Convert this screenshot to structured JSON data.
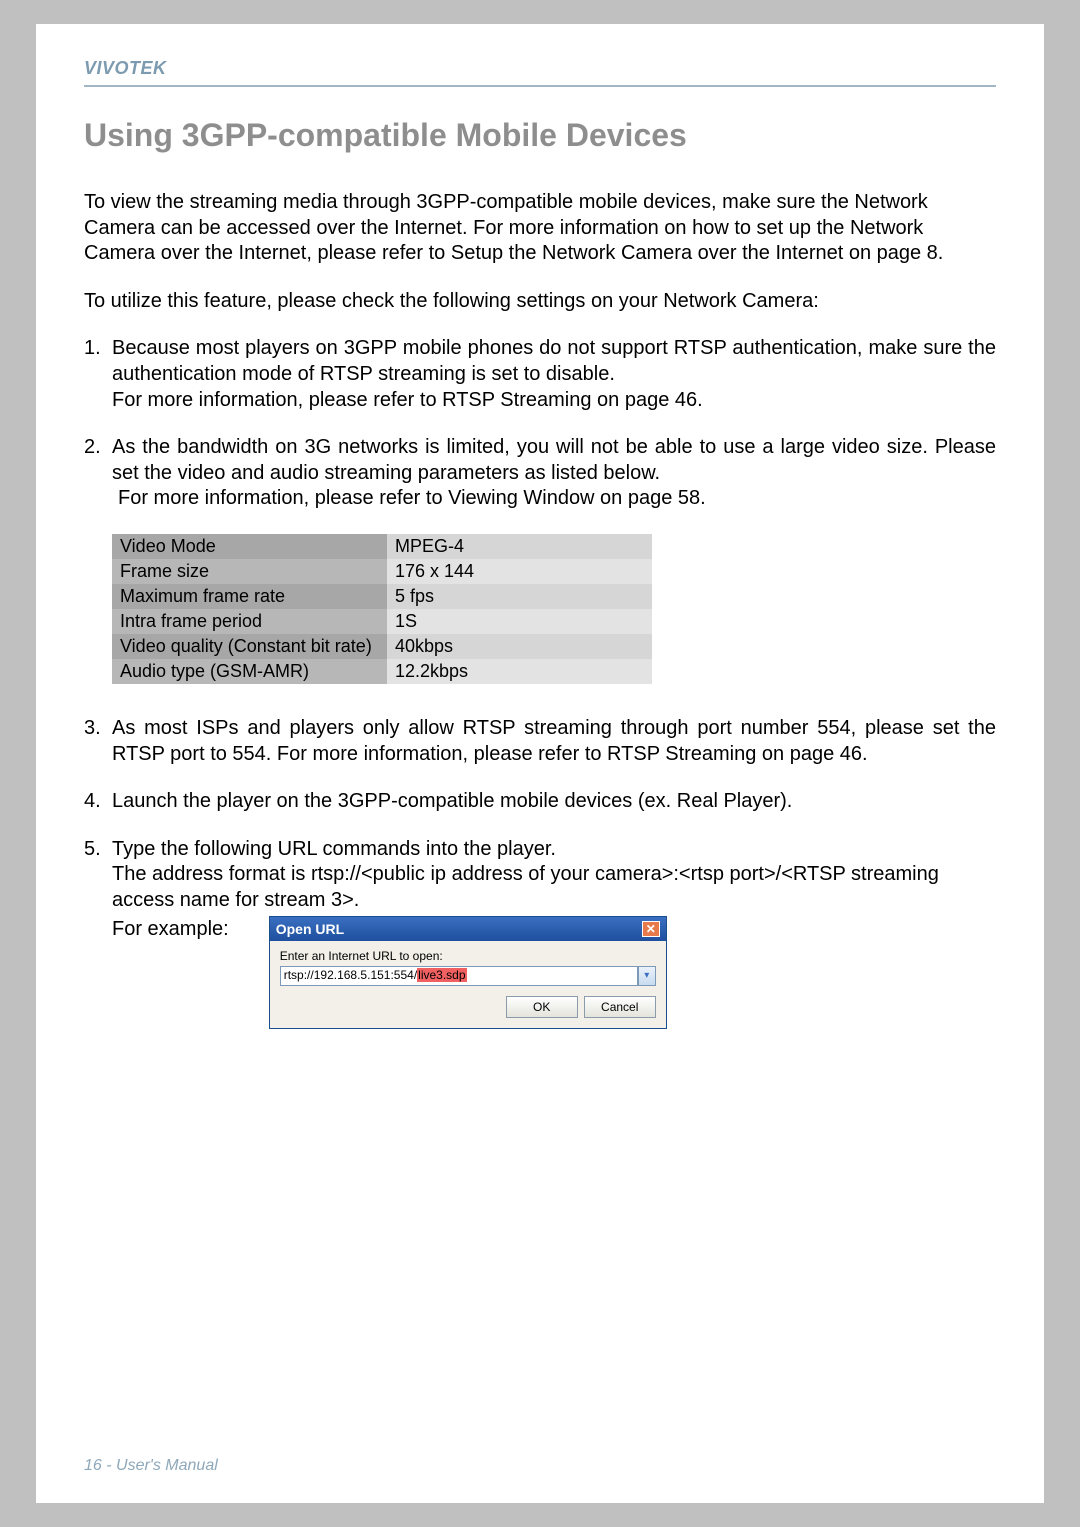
{
  "header": {
    "brand": "VIVOTEK"
  },
  "title": "Using 3GPP-compatible Mobile Devices",
  "intro": "To view the streaming media through 3GPP-compatible mobile devices, make sure the Network Camera can be accessed over the Internet. For more information on how to set up the Network Camera over the Internet, please refer to Setup the Network Camera over the Internet on page 8.",
  "utilize": "To utilize this feature, please check the following settings on your Network Camera:",
  "item1": {
    "num": "1.",
    "line1": "Because most players on 3GPP mobile phones do not support RTSP authentication, make sure the authentication mode of RTSP streaming is set to disable.",
    "line2": "For more information, please refer to RTSP Streaming on page 46."
  },
  "item2": {
    "num": "2.",
    "line1": "As the bandwidth on 3G networks is limited, you will not be able to use a large video size. Please set the video and audio streaming parameters as listed below.",
    "line2": "For more information, please refer to Viewing Window on page 58."
  },
  "settings": [
    {
      "label": "Video Mode",
      "value": "MPEG-4"
    },
    {
      "label": "Frame size",
      "value": "176 x 144"
    },
    {
      "label": "Maximum frame rate",
      "value": "5 fps"
    },
    {
      "label": "Intra frame period",
      "value": "1S"
    },
    {
      "label": "Video quality (Constant bit rate)",
      "value": "40kbps"
    },
    {
      "label": "Audio type (GSM-AMR)",
      "value": "12.2kbps"
    }
  ],
  "item3": {
    "num": "3.",
    "text": "As most ISPs and players only allow RTSP streaming through port number 554, please set the RTSP port to 554. For more information, please refer to RTSP Streaming on page 46."
  },
  "item4": {
    "num": "4.",
    "text": "Launch the player on the 3GPP-compatible mobile devices (ex. Real Player)."
  },
  "item5": {
    "num": "5.",
    "line1": "Type the following URL commands into the player.",
    "line2": "The address format is rtsp://<public ip address of your camera>:<rtsp port>/<RTSP streaming access name for stream 3>.",
    "example_label": "For example:"
  },
  "dialog": {
    "title": "Open URL",
    "label": "Enter an Internet URL to open:",
    "url_prefix": "rtsp://192.168.5.151:554/",
    "url_highlight": "live3.sdp",
    "ok": "OK",
    "cancel": "Cancel"
  },
  "footer": "16 - User's Manual"
}
